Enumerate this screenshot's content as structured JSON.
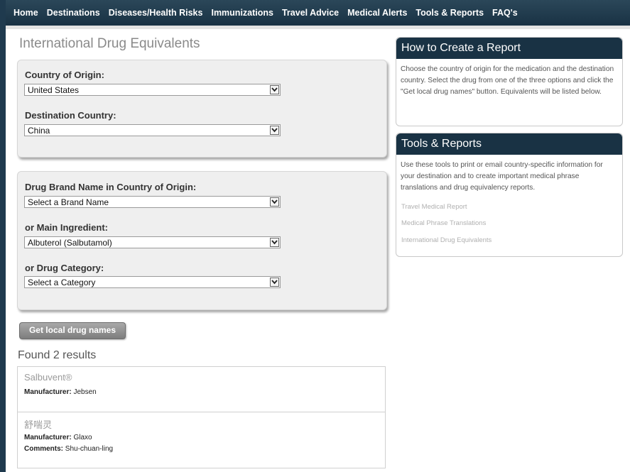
{
  "nav": {
    "items": [
      "Home",
      "Destinations",
      "Diseases/Health Risks",
      "Immunizations",
      "Travel Advice",
      "Medical Alerts",
      "Tools & Reports",
      "FAQ's"
    ]
  },
  "page": {
    "title": "International Drug Equivalents"
  },
  "form": {
    "origin_label": "Country of Origin:",
    "origin_value": "United States",
    "destination_label": "Destination Country:",
    "destination_value": "China",
    "brand_label": "Drug Brand Name in Country of Origin:",
    "brand_value": "Select a Brand Name",
    "ingredient_label": "or Main Ingredient:",
    "ingredient_value": "Albuterol (Salbutamol)",
    "category_label": "or Drug Category:",
    "category_value": "Select a Category",
    "submit_label": "Get local drug names"
  },
  "results": {
    "heading": "Found 2 results",
    "items": [
      {
        "name": "Salbuvent®",
        "manufacturer_label": "Manufacturer:",
        "manufacturer": "Jebsen"
      },
      {
        "name": "舒喘灵",
        "manufacturer_label": "Manufacturer:",
        "manufacturer": "Glaxo",
        "comments_label": "Comments:",
        "comments": "Shu-chuan-ling"
      }
    ]
  },
  "sidebar": {
    "how_to": {
      "title": "How to Create a Report",
      "text": "Choose the country of origin for the medication and the destination country. Select the drug from one of the three options and click the \"Get local drug names\" button. Equivalents will be listed below."
    },
    "tools": {
      "title": "Tools & Reports",
      "text": "Use these tools to print or email country-specific information for your destination and to create important medical phrase translations and drug equivalency reports.",
      "links": [
        "Travel Medical Report",
        "Medical Phrase Translations",
        "International Drug Equivalents"
      ]
    }
  },
  "colors": {
    "nav_bg": "#193244",
    "panel_bg": "#efefef",
    "button": "#8a8a8a"
  },
  "icons": {
    "select_arrow": "chevron-down-icon"
  }
}
